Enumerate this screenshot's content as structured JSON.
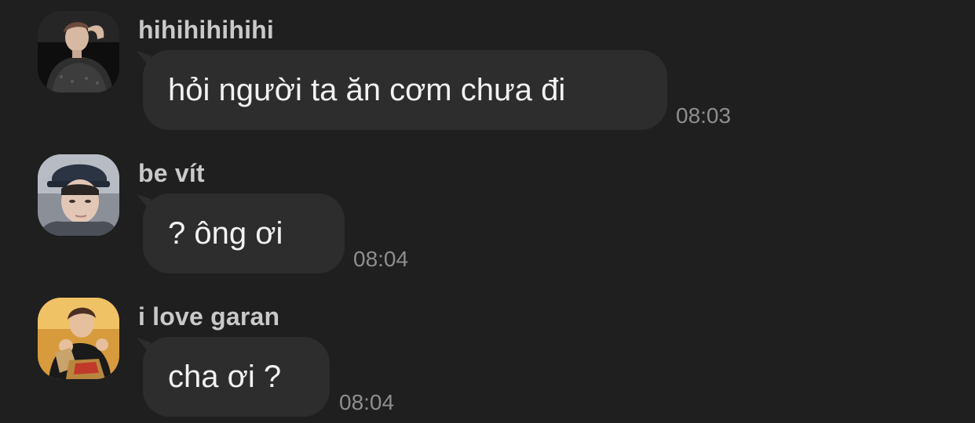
{
  "messages": [
    {
      "sender": "hihihihihihi",
      "text": "hỏi người ta ăn cơm chưa đi",
      "time": "08:03",
      "avatar": "avatar-dark-jacket-man"
    },
    {
      "sender": "be vít",
      "text": "? ông ơi",
      "time": "08:04",
      "avatar": "avatar-cap-selfie"
    },
    {
      "sender": "i love garan",
      "text": "cha ơi ?",
      "time": "08:04",
      "avatar": "avatar-eating-chicken"
    }
  ],
  "colors": {
    "background": "#1f1f1f",
    "bubble": "#2d2d2d",
    "sender_name": "#c9c9c9",
    "message_text": "#f2f2f2",
    "timestamp": "#8e8e8e"
  }
}
